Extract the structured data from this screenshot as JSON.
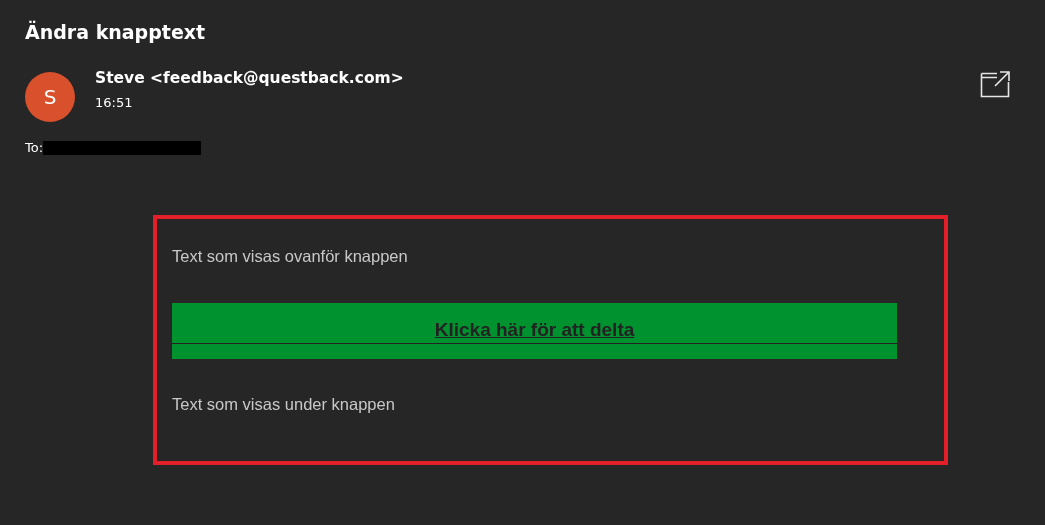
{
  "email": {
    "subject": "Ändra knapptext",
    "sender": {
      "initial": "S",
      "name": "Steve <feedback@questback.com>",
      "time": "16:51"
    },
    "to_label": "To:"
  },
  "message": {
    "text_above": "Text som visas ovanför knappen",
    "button": "Klicka här för att delta",
    "text_below": "Text som visas under knappen"
  }
}
